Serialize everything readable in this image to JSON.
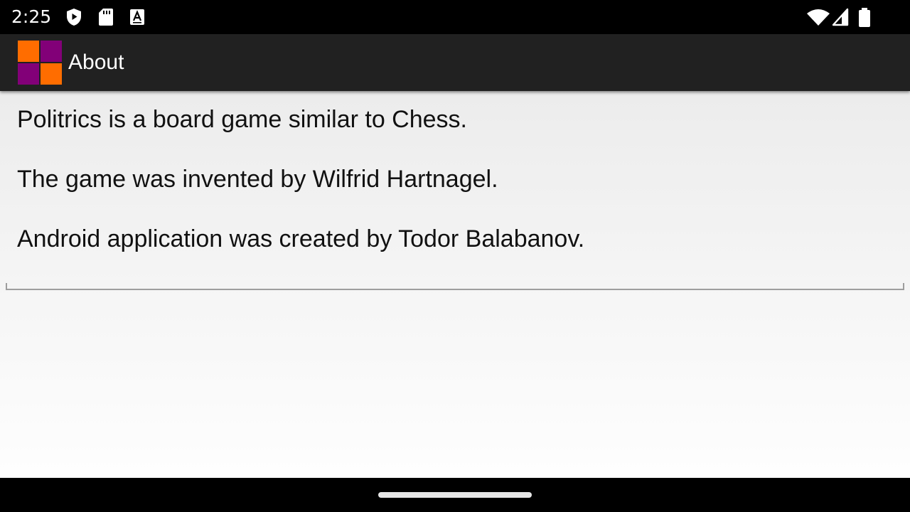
{
  "status_bar": {
    "time": "2:25",
    "left_icons": [
      "play-protect-icon",
      "sd-card-icon",
      "keyboard-a-icon"
    ],
    "right_icons": [
      "wifi-icon",
      "cell-signal-icon",
      "battery-icon"
    ]
  },
  "app_bar": {
    "title": "About",
    "logo_icon": "board-logo-icon",
    "logo_colors": {
      "orange": "#FF6D00",
      "purple": "#820078"
    }
  },
  "content": {
    "lines": [
      "Politrics is a board game similar to Chess.",
      "The game was invented by Wilfrid Hartnagel.",
      "Android application was created by Todor Balabanov."
    ]
  },
  "nav_bar": {
    "handle_icon": "home-handle"
  }
}
